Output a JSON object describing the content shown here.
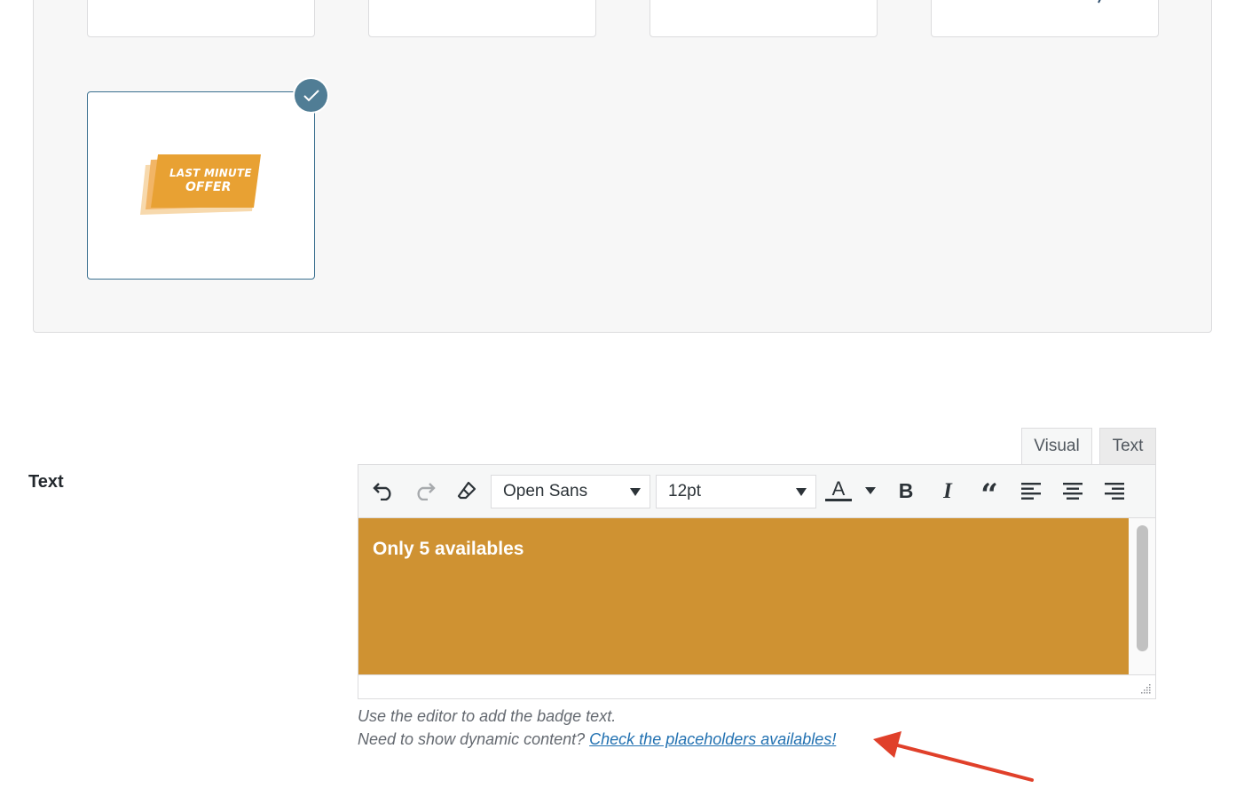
{
  "badge_gallery": {
    "selected_badge": {
      "line1": "LAST MINUTE",
      "line2": "OFFER",
      "color": "#e8a133"
    }
  },
  "text_field": {
    "label": "Text",
    "tabs": {
      "visual": "Visual",
      "text": "Text",
      "active": "visual"
    },
    "toolbar": {
      "font_family": "Open Sans",
      "font_size": "12pt",
      "icons": [
        "undo-icon",
        "redo-icon",
        "clear-formatting-icon",
        "text-color-icon",
        "bold-icon",
        "italic-icon",
        "blockquote-icon",
        "align-left-icon",
        "align-center-icon",
        "align-right-icon"
      ]
    },
    "content": {
      "text": "Only 5 availables",
      "background": "#cf9232",
      "color": "#ffffff"
    },
    "help_line1": "Use the editor to add the badge text.",
    "help_line2_prefix": "Need to show dynamic content? ",
    "help_link": "Check the placeholders availables!"
  },
  "colors": {
    "accent": "#507d95",
    "link": "#2271b1",
    "annotation_arrow": "#e0402a"
  }
}
